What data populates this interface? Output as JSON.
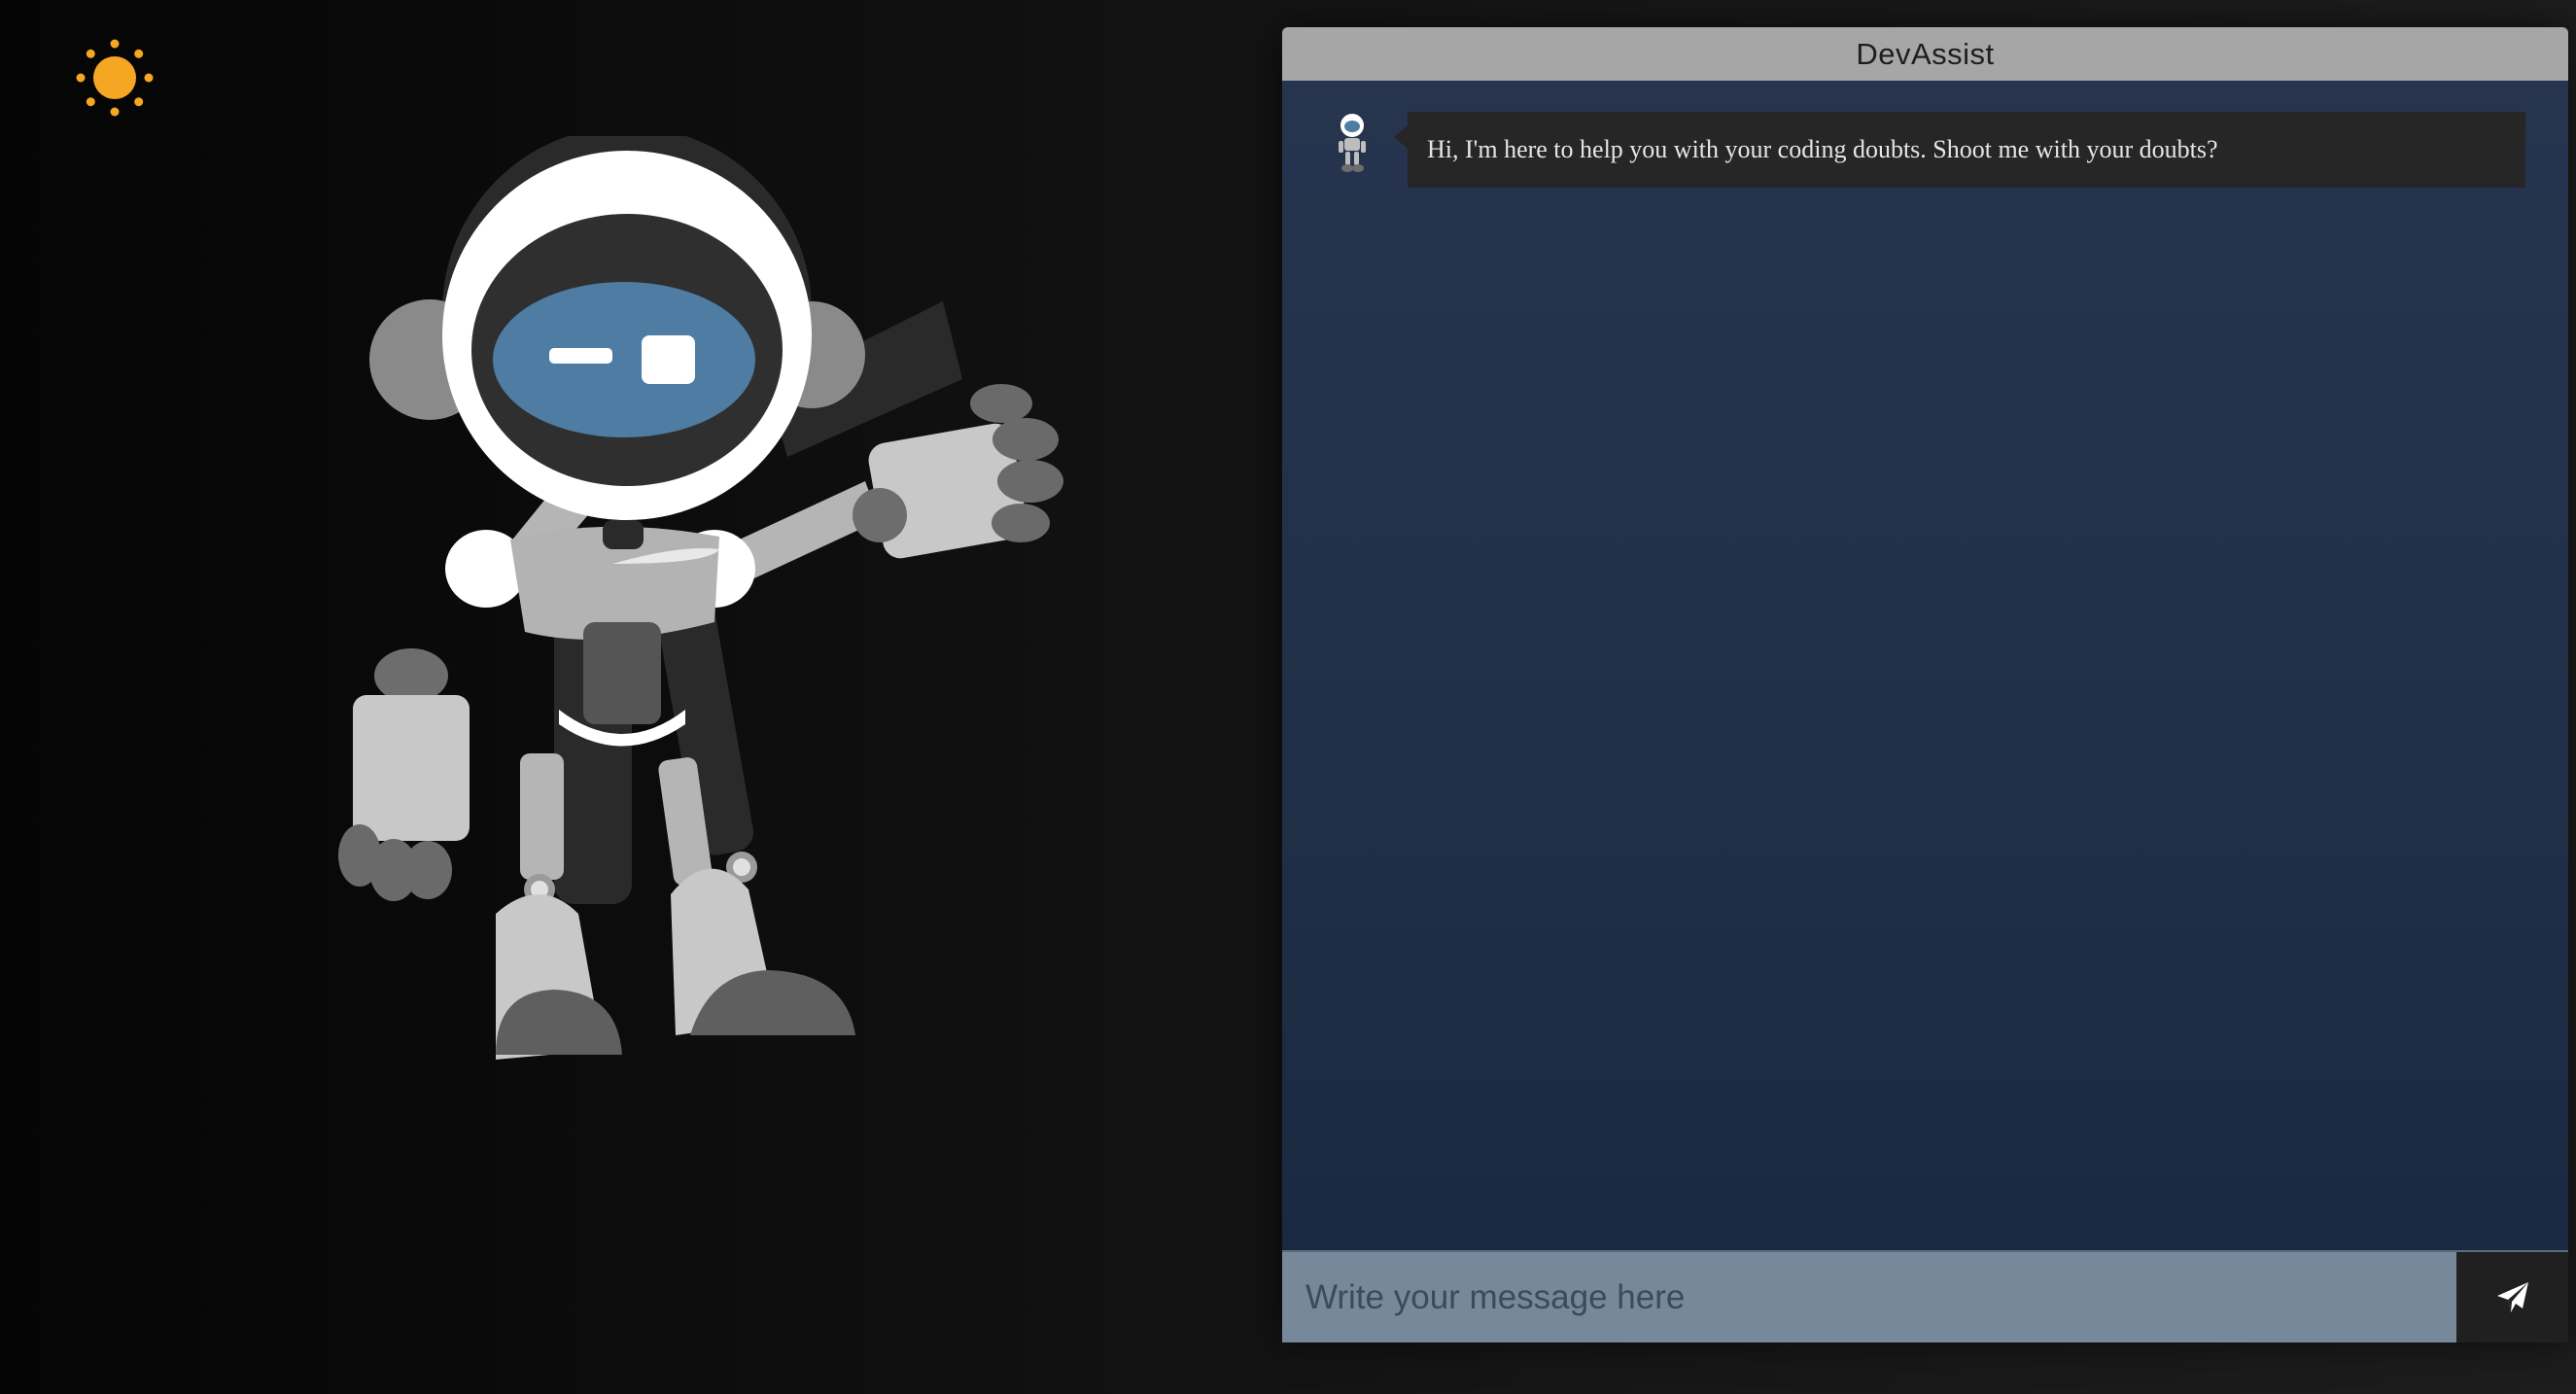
{
  "app": {
    "theme_icon": "sun-icon",
    "accent_color": "#f5a623"
  },
  "chat": {
    "title": "DevAssist",
    "messages": [
      {
        "sender": "bot",
        "avatar_icon": "robot-avatar-icon",
        "text": "Hi, I'm here to help you with your coding doubts. Shoot me with your doubts?"
      }
    ],
    "input": {
      "placeholder": "Write your message here",
      "value": ""
    },
    "send_icon": "paper-plane-icon"
  },
  "colors": {
    "header_bg": "#a6a6a6",
    "chat_bg": "#223149",
    "bubble_bg": "#262626",
    "input_bg": "#76889a",
    "send_bg": "#202020"
  }
}
